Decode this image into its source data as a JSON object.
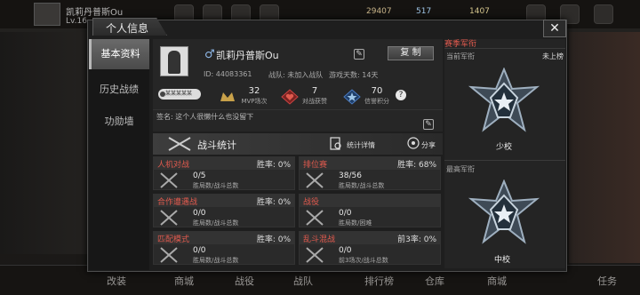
{
  "topbar": {
    "player_name": "凯莉丹普斯Ou",
    "level": "Lv.16",
    "coins": "29407",
    "gems": "517",
    "badge_count": "1407"
  },
  "window": {
    "title": "个人信息",
    "close_label": "✕"
  },
  "nav": {
    "items": [
      {
        "label": "基本资料",
        "active": true
      },
      {
        "label": "历史战绩",
        "active": false
      },
      {
        "label": "功勋墙",
        "active": false
      }
    ]
  },
  "profile": {
    "gender_symbol": "♂",
    "name": "凯莉丹普斯Ou",
    "copy_label": "复 制",
    "id_text": "ID: 44083361",
    "team_text": "战队: 未加入战队",
    "days_text": "游戏天数: 14天",
    "friend_tag": "某某某某某",
    "stats": [
      {
        "icon": "mvp-icon",
        "value": "32",
        "label": "MVP场次"
      },
      {
        "icon": "heart-icon",
        "value": "7",
        "label": "对战获赞"
      },
      {
        "icon": "star-icon",
        "value": "70",
        "label": "信誉积分"
      }
    ],
    "help": "?",
    "signature": "签名: 这个人很懒什么也没留下"
  },
  "combat": {
    "title": "战斗统计",
    "detail_label": "统计详情",
    "share_label": "分享"
  },
  "cards": [
    {
      "mode": "人机对战",
      "rate": "胜率: 0%",
      "value": "0/5",
      "sub": "胜局数/战斗总数"
    },
    {
      "mode": "排位赛",
      "rate": "胜率: 68%",
      "value": "38/56",
      "sub": "胜局数/战斗总数"
    },
    {
      "mode": "合作遭遇战",
      "rate": "胜率: 0%",
      "value": "0/0",
      "sub": "胜局数/战斗总数"
    },
    {
      "mode": "战役",
      "rate": "",
      "value": "0/0",
      "sub": "胜局数/困难"
    },
    {
      "mode": "匹配模式",
      "rate": "胜率: 0%",
      "value": "0/0",
      "sub": "胜局数/战斗总数"
    },
    {
      "mode": "乱斗混战",
      "rate": "前3率: 0%",
      "value": "0/0",
      "sub": "前3场次/战斗总数"
    }
  ],
  "rank": {
    "header": "赛季军衔",
    "current_label": "当前军衔",
    "current_status": "未上榜",
    "current_rank": "少校",
    "highest_label": "最高军衔",
    "highest_rank": "中校"
  },
  "bottombar": [
    "改装",
    "商城",
    "战役",
    "战队",
    "排行榜",
    "仓库",
    "商城",
    "任务"
  ],
  "colors": {
    "accent_red": "#e05a4e",
    "panel_bg": "#1e1e1e",
    "insignia": "#9fb0c0"
  }
}
